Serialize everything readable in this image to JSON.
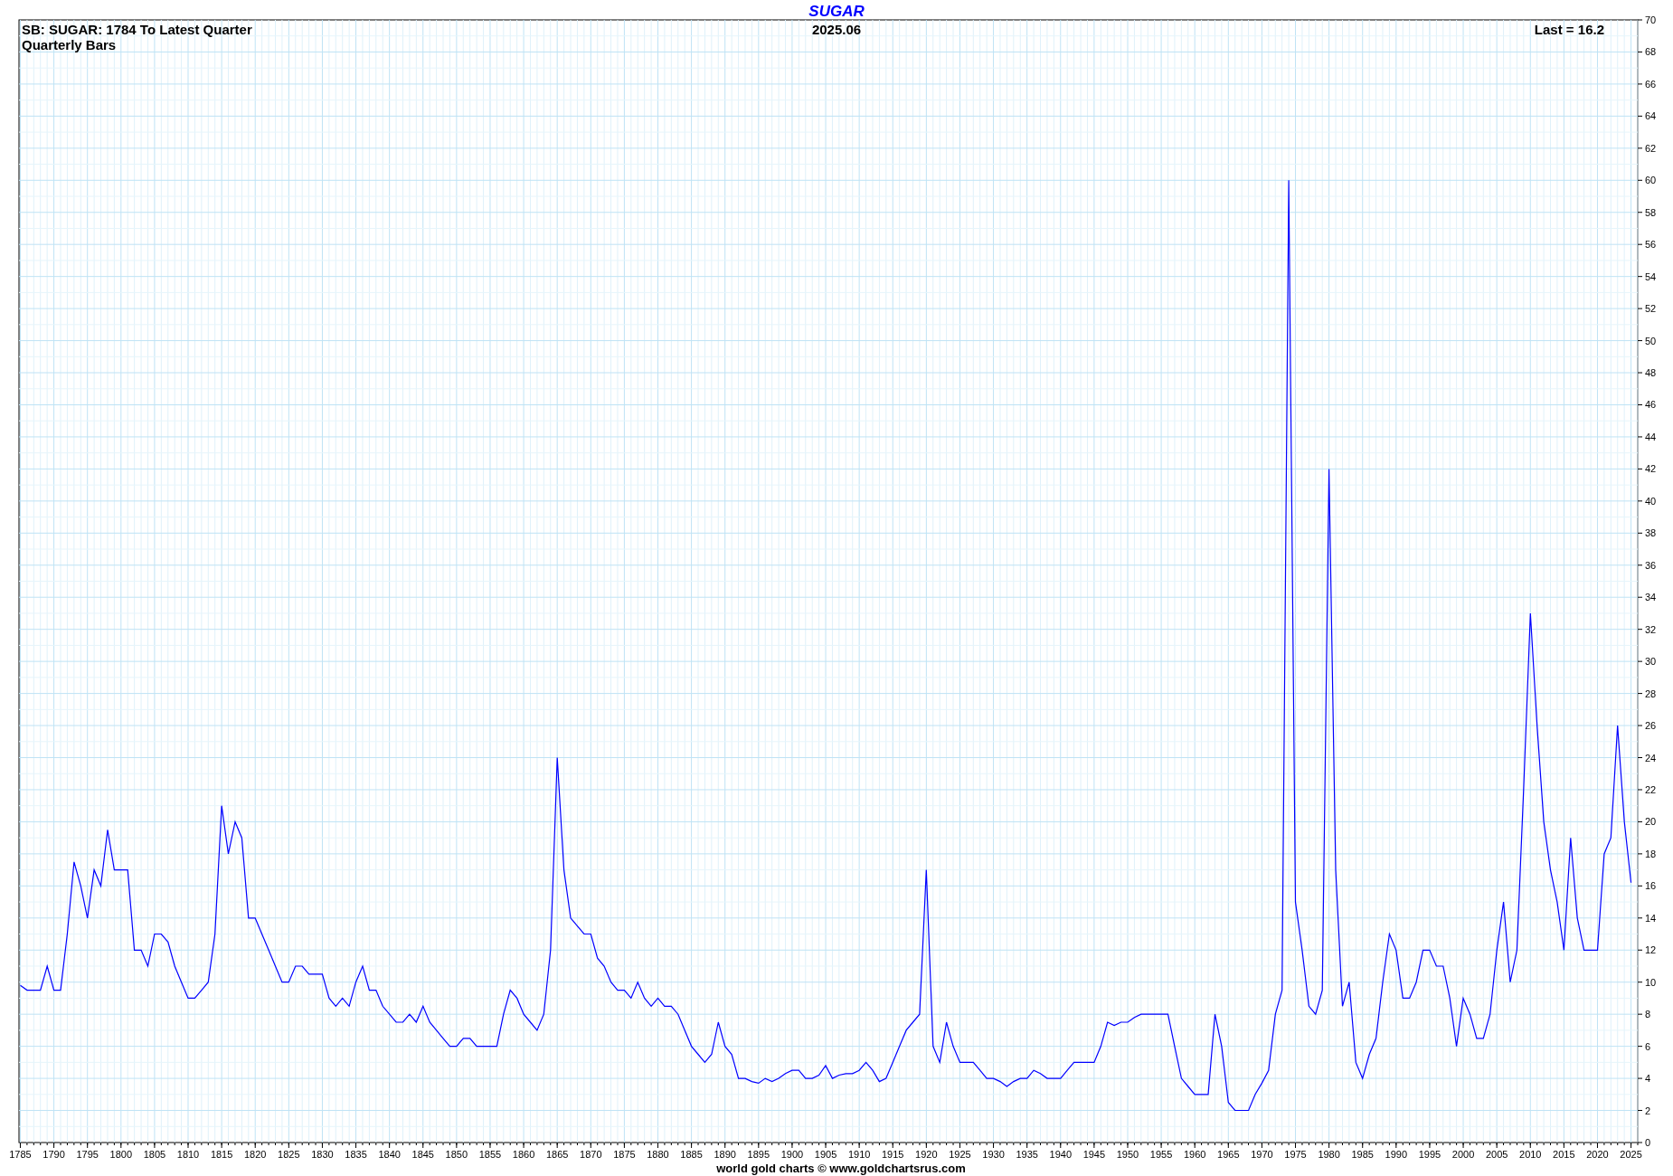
{
  "header": {
    "subtitle": "SB: SUGAR: 1784 To Latest Quarter",
    "bar_type": "Quarterly Bars",
    "date": "2025.06",
    "last": "Last = 16.2"
  },
  "chart": {
    "chart_data": {
      "type": "line",
      "title": "SUGAR",
      "x": [
        1785,
        1786,
        1787,
        1788,
        1789,
        1790,
        1791,
        1792,
        1793,
        1794,
        1795,
        1796,
        1797,
        1798,
        1799,
        1800,
        1801,
        1802,
        1803,
        1804,
        1805,
        1806,
        1807,
        1808,
        1809,
        1810,
        1811,
        1812,
        1813,
        1814,
        1815,
        1816,
        1817,
        1818,
        1819,
        1820,
        1821,
        1822,
        1823,
        1824,
        1825,
        1826,
        1827,
        1828,
        1829,
        1830,
        1831,
        1832,
        1833,
        1834,
        1835,
        1836,
        1837,
        1838,
        1839,
        1840,
        1841,
        1842,
        1843,
        1844,
        1845,
        1846,
        1847,
        1848,
        1849,
        1850,
        1851,
        1852,
        1853,
        1854,
        1855,
        1856,
        1857,
        1858,
        1859,
        1860,
        1861,
        1862,
        1863,
        1864,
        1865,
        1866,
        1867,
        1868,
        1869,
        1870,
        1871,
        1872,
        1873,
        1874,
        1875,
        1876,
        1877,
        1878,
        1879,
        1880,
        1881,
        1882,
        1883,
        1884,
        1885,
        1886,
        1887,
        1888,
        1889,
        1890,
        1891,
        1892,
        1893,
        1894,
        1895,
        1896,
        1897,
        1898,
        1899,
        1900,
        1901,
        1902,
        1903,
        1904,
        1905,
        1906,
        1907,
        1908,
        1909,
        1910,
        1911,
        1912,
        1913,
        1914,
        1915,
        1916,
        1917,
        1918,
        1919,
        1920,
        1921,
        1922,
        1923,
        1924,
        1925,
        1926,
        1927,
        1928,
        1929,
        1930,
        1931,
        1932,
        1933,
        1934,
        1935,
        1936,
        1937,
        1938,
        1939,
        1940,
        1941,
        1942,
        1943,
        1944,
        1945,
        1946,
        1947,
        1948,
        1949,
        1950,
        1951,
        1952,
        1953,
        1954,
        1955,
        1956,
        1957,
        1958,
        1959,
        1960,
        1961,
        1962,
        1963,
        1964,
        1965,
        1966,
        1967,
        1968,
        1969,
        1970,
        1971,
        1972,
        1973,
        1974,
        1975,
        1976,
        1977,
        1978,
        1979,
        1980,
        1981,
        1982,
        1983,
        1984,
        1985,
        1986,
        1987,
        1988,
        1989,
        1990,
        1991,
        1992,
        1993,
        1994,
        1995,
        1996,
        1997,
        1998,
        1999,
        2000,
        2001,
        2002,
        2003,
        2004,
        2005,
        2006,
        2007,
        2008,
        2009,
        2010,
        2011,
        2012,
        2013,
        2014,
        2015,
        2016,
        2017,
        2018,
        2019,
        2020,
        2021,
        2022,
        2023,
        2024,
        2025
      ],
      "grid": true,
      "series": [
        {
          "color": "#0000ff",
          "values": [
            9.8,
            9.5,
            9.5,
            9.5,
            11,
            9.5,
            9.5,
            13,
            17.5,
            16,
            14,
            17,
            16,
            19.5,
            17,
            17,
            17,
            12,
            12,
            11,
            13,
            13,
            12.5,
            11,
            10,
            9,
            9,
            9.5,
            10,
            13,
            21,
            18,
            20,
            19,
            14,
            14,
            13,
            12,
            11,
            10,
            10,
            11,
            11,
            10.5,
            10.5,
            10.5,
            9,
            8.5,
            9,
            8.5,
            10,
            11,
            9.5,
            9.5,
            8.5,
            8,
            7.5,
            7.5,
            8,
            7.5,
            8.5,
            7.5,
            7,
            6.5,
            6,
            6,
            6.5,
            6.5,
            6,
            6,
            6,
            6,
            8,
            9.5,
            9,
            8,
            7.5,
            7,
            8,
            12,
            24,
            17,
            14,
            13.5,
            13,
            13,
            11.5,
            11,
            10,
            9.5,
            9.5,
            9,
            10,
            9,
            8.5,
            9,
            8.5,
            8.5,
            8,
            7,
            6,
            5.5,
            5,
            5.5,
            7.5,
            6,
            5.5,
            4,
            4,
            3.8,
            3.7,
            4,
            3.8,
            4,
            4.3,
            4.5,
            4.5,
            4,
            4,
            4.2,
            4.8,
            4,
            4.2,
            4.3,
            4.3,
            4.5,
            5,
            4.5,
            3.8,
            4,
            5,
            6,
            7,
            7.5,
            8,
            17,
            6,
            5,
            7.5,
            6,
            5,
            5,
            5,
            4.5,
            4,
            4,
            3.8,
            3.5,
            3.8,
            4,
            4,
            4.5,
            4.3,
            4,
            4,
            4,
            4.5,
            5,
            5,
            5,
            5,
            6,
            7.5,
            7.3,
            7.5,
            7.5,
            7.8,
            8,
            8,
            8,
            8,
            8,
            6,
            4,
            3.5,
            3,
            3,
            3,
            8,
            6,
            2.5,
            2,
            2,
            2,
            3,
            3.7,
            4.5,
            8,
            9.5,
            60,
            15,
            12,
            8.5,
            8,
            9.5,
            42,
            17,
            8.5,
            10,
            5,
            4,
            5.5,
            6.5,
            10,
            13,
            12,
            9,
            9,
            10,
            12,
            12,
            11,
            11,
            9,
            6,
            9,
            8,
            6.5,
            6.5,
            8,
            12,
            15,
            10,
            12,
            22,
            33,
            26,
            20,
            17,
            15,
            12,
            19,
            14,
            12,
            12,
            12,
            18,
            19,
            26,
            20,
            16.2
          ]
        }
      ],
      "xlim": [
        1784.8,
        2026
      ],
      "ylim": [
        0,
        70
      ],
      "xticks": [
        1785,
        1790,
        1795,
        1800,
        1805,
        1810,
        1815,
        1820,
        1825,
        1830,
        1835,
        1840,
        1845,
        1850,
        1855,
        1860,
        1865,
        1870,
        1875,
        1880,
        1885,
        1890,
        1895,
        1900,
        1905,
        1910,
        1915,
        1920,
        1925,
        1930,
        1935,
        1940,
        1945,
        1950,
        1955,
        1960,
        1965,
        1970,
        1975,
        1980,
        1985,
        1990,
        1995,
        2000,
        2005,
        2010,
        2015,
        2020,
        2025
      ],
      "yticks": [
        0,
        2,
        4,
        6,
        8,
        10,
        12,
        14,
        16,
        18,
        20,
        22,
        24,
        26,
        28,
        30,
        32,
        34,
        36,
        38,
        40,
        42,
        44,
        46,
        48,
        50,
        52,
        54,
        56,
        58,
        60,
        62,
        64,
        66,
        68,
        70
      ]
    }
  },
  "footer": "world gold charts © www.goldchartsrus.com"
}
